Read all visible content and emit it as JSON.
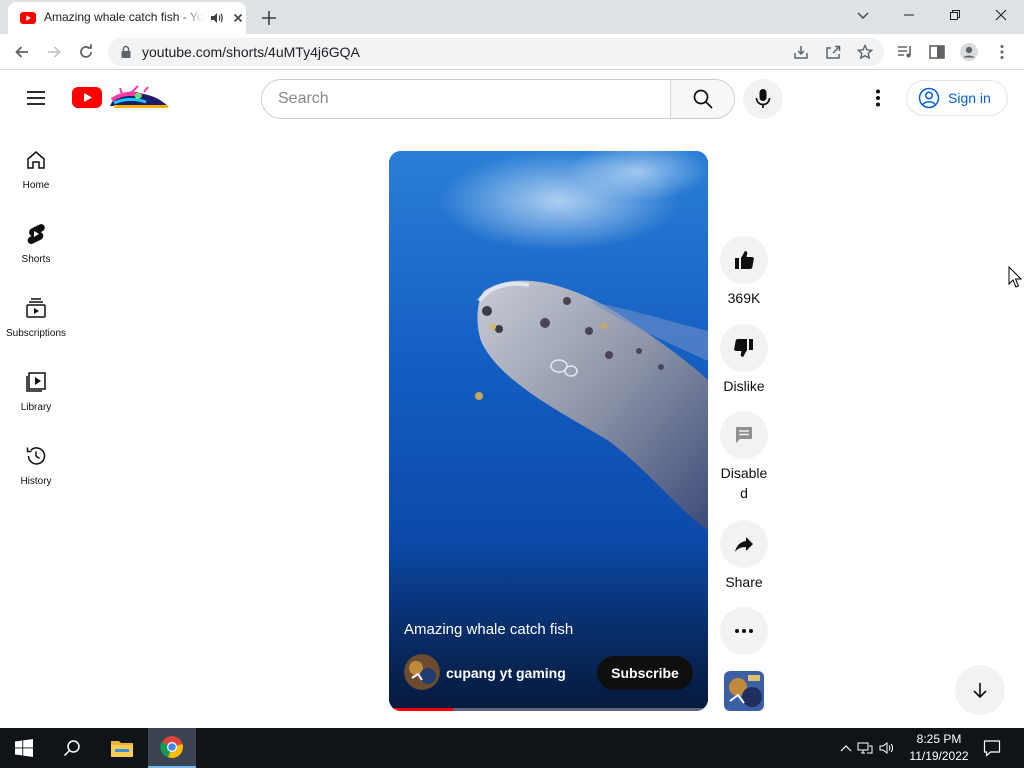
{
  "browser": {
    "tab_title": "Amazing whale catch fish - YouTube",
    "url": "youtube.com/shorts/4uMTy4j6GQA"
  },
  "masthead": {
    "search_placeholder": "Search",
    "sign_in_label": "Sign in"
  },
  "guide": {
    "items": [
      {
        "label": "Home",
        "icon": "home-icon"
      },
      {
        "label": "Shorts",
        "icon": "shorts-icon"
      },
      {
        "label": "Subscriptions",
        "icon": "subscriptions-icon"
      },
      {
        "label": "Library",
        "icon": "library-icon"
      },
      {
        "label": "History",
        "icon": "history-icon"
      }
    ]
  },
  "short": {
    "title": "Amazing whale catch fish",
    "channel_name": "cupang yt gaming",
    "subscribe_label": "Subscribe",
    "progress_fraction": 0.2
  },
  "actions": {
    "like_count": "369K",
    "dislike_label": "Dislike",
    "comments_label": "Disabled",
    "share_label": "Share"
  },
  "taskbar": {
    "time": "8:25 PM",
    "date": "11/19/2022"
  },
  "colors": {
    "youtube_red": "#ff0000",
    "link_blue": "#065fd4",
    "taskbar": "#101418"
  }
}
